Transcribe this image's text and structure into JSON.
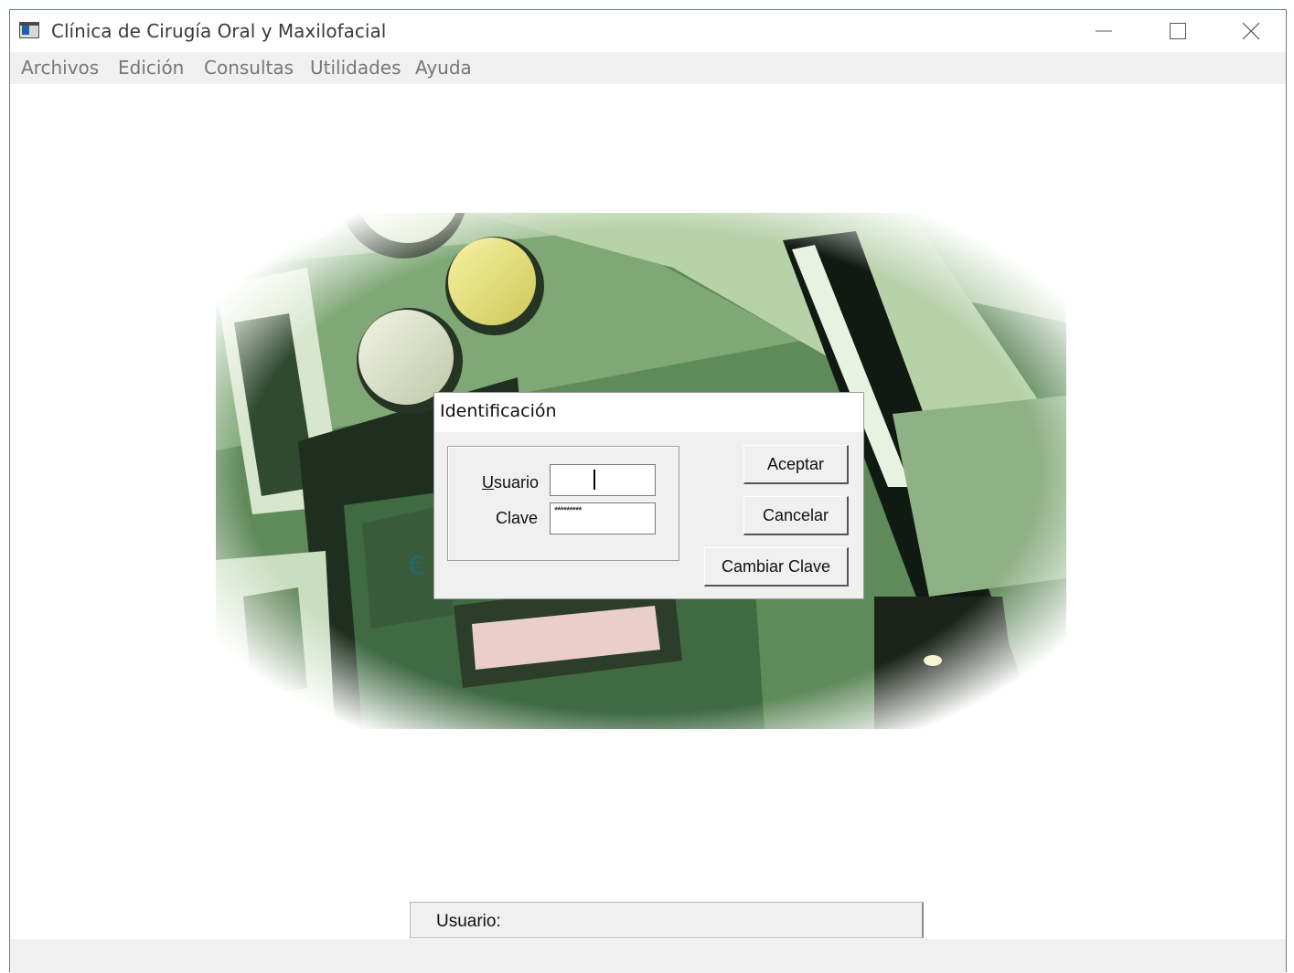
{
  "window": {
    "title": "Clínica de Cirugía Oral y Maxilofacial"
  },
  "menu": {
    "items": [
      "Archivos",
      "Edición",
      "Consultas",
      "Utilidades",
      "Ayuda"
    ]
  },
  "dialog": {
    "title": "Identificación",
    "user_label": "Usuario",
    "password_label": "Clave",
    "user_value": "",
    "password_value": "*********",
    "buttons": {
      "accept": "Aceptar",
      "cancel": "Cancelar",
      "change": "Cambiar Clave"
    }
  },
  "background": {
    "euro_sign": "€"
  },
  "status": {
    "user_label": "Usuario:"
  },
  "colors": {
    "accent": "#1e5fa8",
    "menu_bg": "#f0f0f0",
    "dialog_bg": "#f0f0f0"
  }
}
